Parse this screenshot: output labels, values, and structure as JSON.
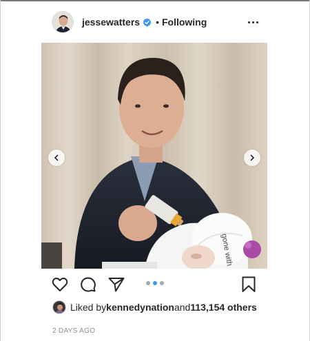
{
  "header": {
    "username": "jessewatters",
    "separator": "•",
    "follow_status": "Following"
  },
  "photo": {
    "cap_text": "gone with"
  },
  "carousel": {
    "slide_count": 3,
    "active_index": 1
  },
  "likes": {
    "prefix": "Liked by ",
    "liker": "kennedynation",
    "middle": " and ",
    "others": "113,154 others"
  },
  "timestamp": "2 DAYS AGO",
  "colors": {
    "text": "#262626",
    "muted": "#8e8e8e",
    "verified_blue": "#3897f0",
    "active_dot": "#3897f0",
    "inactive_dot": "#a8a8a8"
  }
}
